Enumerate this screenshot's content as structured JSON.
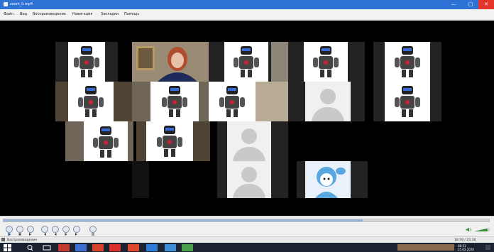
{
  "window": {
    "title": "zoom_0.mp4",
    "minimize_glyph": "—",
    "maximize_glyph": "□",
    "close_glyph": "✕"
  },
  "menu": {
    "items": [
      "Файл",
      "Вид",
      "Воспроизведение",
      "Навигация",
      "Закладки",
      "Помощь"
    ]
  },
  "statusbar": {
    "text": "Воспроизведение",
    "time": "18:59 / 25:38"
  },
  "taskbar": {
    "clock": "08:51",
    "date": "25.03.2020"
  },
  "volume": {
    "level": 0.85
  },
  "playback": {
    "progress": 0.74
  },
  "colors": {
    "accent": "#2f72d6",
    "close": "#e5352b"
  }
}
